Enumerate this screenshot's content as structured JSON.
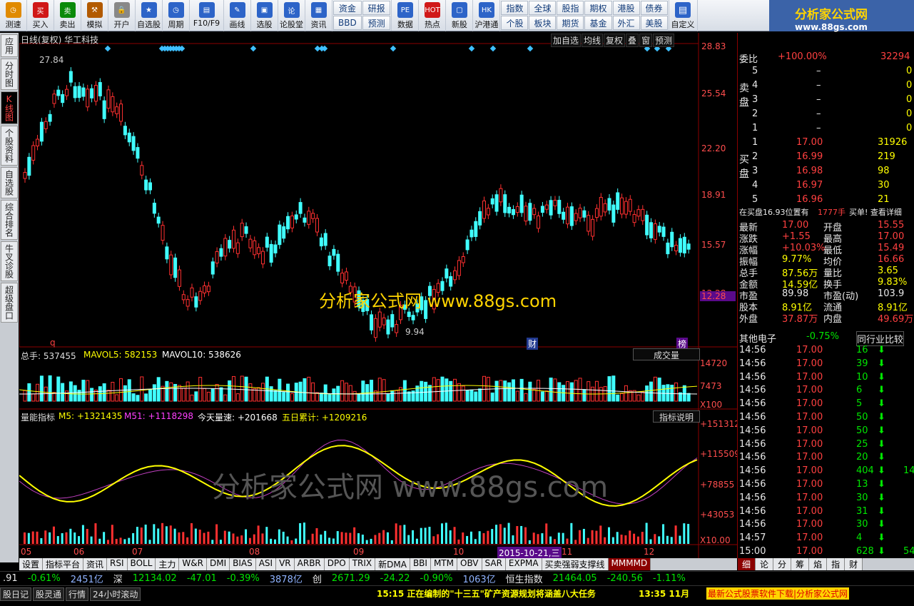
{
  "toolbar": {
    "buttons": [
      {
        "label": "测速",
        "icon": "clock-icon",
        "color": "#e08a00"
      },
      {
        "label": "买入",
        "icon": "buy-icon",
        "color": "#d01818"
      },
      {
        "label": "卖出",
        "icon": "sell-icon",
        "color": "#0a8a0a"
      },
      {
        "label": "模拟",
        "icon": "hammer-icon",
        "color": "#b25a00"
      },
      {
        "label": "开户",
        "icon": "lock-icon",
        "color": "#888"
      },
      {
        "label": "自选股",
        "icon": "star-icon",
        "color": "#2d64c8"
      },
      {
        "label": "周期",
        "icon": "clock-icon",
        "color": "#2d64c8"
      },
      {
        "label": "F10/F9",
        "icon": "doc-icon",
        "color": "#2d64c8"
      },
      {
        "label": "画线",
        "icon": "pen-icon",
        "color": "#2d64c8"
      },
      {
        "label": "选股",
        "icon": "monitor-icon",
        "color": "#2d64c8"
      },
      {
        "label": "论股堂",
        "icon": "talk-icon",
        "color": "#2d64c8"
      },
      {
        "label": "资讯",
        "icon": "news-icon",
        "color": "#2d64c8"
      }
    ],
    "grid1": [
      "资金",
      "研报",
      "BBD",
      "预测"
    ],
    "buttons2": [
      {
        "label": "数据",
        "icon": "pe-icon",
        "color": "#2d64c8"
      },
      {
        "label": "热点",
        "icon": "hot-icon",
        "color": "#d01818"
      },
      {
        "label": "新股",
        "icon": "new-icon",
        "color": "#2d64c8"
      },
      {
        "label": "沪港通",
        "icon": "hk-icon",
        "color": "#2d64c8"
      }
    ],
    "grid2": [
      "指数",
      "全球",
      "股指",
      "期权",
      "港股",
      "债券",
      "个股",
      "板块",
      "期货",
      "基金",
      "外汇",
      "美股"
    ],
    "custom": "自定义",
    "logo_title": "分析家公式网",
    "logo_url": "www.88gs.com"
  },
  "left_tabs": [
    "应用",
    "分时图",
    "K线图",
    "个股资料",
    "自选股",
    "综合排名",
    "牛叉诊股",
    "超级盘口"
  ],
  "chart": {
    "title": "日线(复权) 华工科技",
    "top_buttons": [
      "加自选",
      "均线",
      "复权",
      "叠",
      "窗",
      "预测"
    ],
    "price_axis": [
      "28.83",
      "25.54",
      "22.20",
      "18.91",
      "15.57",
      "12.28"
    ],
    "high_label": "27.84",
    "low_label": "9.94",
    "current_tag": "12.28",
    "markers": [
      "q",
      "财",
      "榜"
    ],
    "watermark": "分析家公式网 www.88gs.com",
    "vol_panel": {
      "label1": "总手: 537455",
      "label2": "MAVOL5: 582153",
      "label3": "MAVOL10: 538626",
      "selector": "成交量",
      "axis": [
        "14720",
        "7473",
        "X100"
      ]
    },
    "ind_panel": {
      "label1": "量能指标",
      "label2": "M5: +1321435",
      "label3": "M51: +1118298",
      "label4": "今天量速: +201668",
      "label5": "五日累计: +1209216",
      "btn": "指标说明",
      "axis": [
        "+151312",
        "+115509",
        "+78855",
        "+43053",
        "X10.00"
      ]
    },
    "x_axis": [
      "05",
      "06",
      "07",
      "08",
      "09",
      "10",
      "11",
      "12"
    ],
    "date_tag": "2015-10-21,三"
  },
  "bottom_tabs": [
    "设置",
    "指标平台",
    "资讯",
    "RSI",
    "BOLL",
    "主力",
    "W&R",
    "DMI",
    "BIAS",
    "ASI",
    "VR",
    "ARBR",
    "DPO",
    "TRIX",
    "新DMA",
    "BBI",
    "MTM",
    "OBV",
    "SAR",
    "EXPMA",
    "买卖强弱支撑线",
    "MMMMD"
  ],
  "quote": {
    "weibi": "委比",
    "weibi_pct": "+100.00%",
    "weibi_val": "32294",
    "sell": [
      {
        "n": "5",
        "p": "–",
        "v": "0"
      },
      {
        "n": "4",
        "p": "–",
        "v": "0"
      },
      {
        "n": "3",
        "p": "–",
        "v": "0"
      },
      {
        "n": "2",
        "p": "–",
        "v": "0"
      },
      {
        "n": "1",
        "p": "–",
        "v": "0"
      }
    ],
    "buy": [
      {
        "n": "1",
        "p": "17.00",
        "v": "31926"
      },
      {
        "n": "2",
        "p": "16.99",
        "v": "219"
      },
      {
        "n": "3",
        "p": "16.98",
        "v": "98"
      },
      {
        "n": "4",
        "p": "16.97",
        "v": "30"
      },
      {
        "n": "5",
        "p": "16.96",
        "v": "21"
      }
    ],
    "sell_label": "卖盘",
    "buy_label": "买盘",
    "note": "在买盘16.93位置有",
    "note_qty": "1777手",
    "note_link": "买单! 查看详细",
    "stats": [
      [
        "最新",
        "17.00",
        "开盘",
        "15.55"
      ],
      [
        "涨跌",
        "+1.55",
        "最高",
        "17.00"
      ],
      [
        "涨幅",
        "+10.03%",
        "最低",
        "15.49"
      ],
      [
        "振幅",
        "9.77%",
        "均价",
        "16.66"
      ],
      [
        "总手",
        "87.56万",
        "量比",
        "3.65"
      ],
      [
        "金额",
        "14.59亿",
        "换手",
        "9.83%"
      ],
      [
        "市盈",
        "89.98",
        "市盈(动)",
        "103.9"
      ],
      [
        "股本",
        "8.91亿",
        "流通",
        "8.91亿"
      ],
      [
        "外盘",
        "37.87万",
        "内盘",
        "49.69万"
      ]
    ],
    "sector": "其他电子",
    "sector_pct": "-0.75%",
    "sector_btn": "同行业比较",
    "ticks": [
      [
        "14:56",
        "17.00",
        "16"
      ],
      [
        "14:56",
        "17.00",
        "39"
      ],
      [
        "14:56",
        "17.00",
        "10"
      ],
      [
        "14:56",
        "17.00",
        "6"
      ],
      [
        "14:56",
        "17.00",
        "5"
      ],
      [
        "14:56",
        "17.00",
        "50"
      ],
      [
        "14:56",
        "17.00",
        "50"
      ],
      [
        "14:56",
        "17.00",
        "25"
      ],
      [
        "14:56",
        "17.00",
        "20"
      ],
      [
        "14:56",
        "17.00",
        "404"
      ],
      [
        "14:56",
        "17.00",
        "13"
      ],
      [
        "14:56",
        "17.00",
        "30"
      ],
      [
        "14:56",
        "17.00",
        "31"
      ],
      [
        "14:56",
        "17.00",
        "30"
      ],
      [
        "14:57",
        "17.00",
        "4"
      ],
      [
        "15:00",
        "17.00",
        "628"
      ]
    ],
    "tick_extra": [
      "",
      "",
      "",
      "",
      "",
      "",
      "",
      "",
      "",
      "14",
      "",
      "",
      "",
      "",
      "",
      "54"
    ],
    "rtabs": [
      "细",
      "论",
      "分",
      "筹",
      "焰",
      "指",
      "财"
    ]
  },
  "status": {
    "items": [
      ".91",
      "-0.61%",
      "2451亿",
      "深",
      "12134.02",
      "-47.01",
      "-0.39%",
      "3878亿",
      "创",
      "2671.29",
      "-24.22",
      "-0.90%",
      "1063亿",
      "恒生指数",
      "21464.05",
      "-240.56",
      "-1.11%"
    ]
  },
  "news": {
    "left": [
      "股日记",
      "股灵通",
      "行情",
      "24小时滚动"
    ],
    "headline1": "15:15 正在编制的\"十三五\"矿产资源规划将涵盖八大任务",
    "headline2": "13:35 11月",
    "scroll": "最新公式股票软件下载|分析家公式网"
  }
}
